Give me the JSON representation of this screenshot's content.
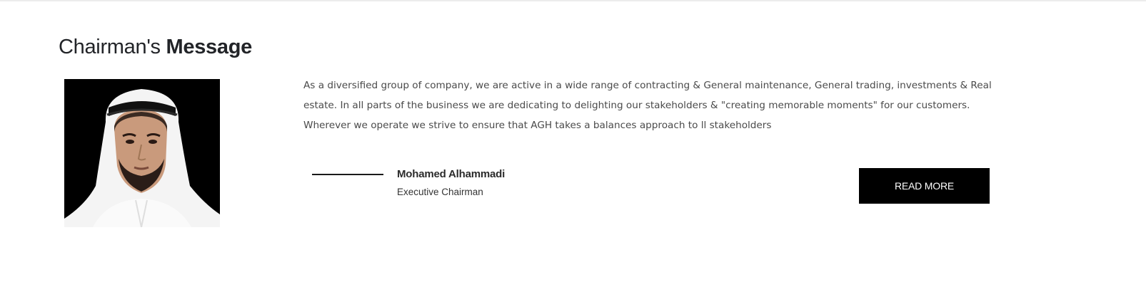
{
  "section": {
    "title_regular": "Chairman's",
    "title_bold": "Message",
    "message": "As a diversified group of company, we are active in a wide range of contracting & General maintenance, General trading, investments & Real estate. In all parts of the business we are dedicating to delighting our stakeholders & \"creating memorable moments\" for our customers. Wherever we operate we strive to ensure that AGH takes a balances approach to ll stakeholders",
    "signature": {
      "name": "Mohamed Alhammadi",
      "role": "Executive Chairman"
    },
    "read_more_label": "READ MORE"
  },
  "colors": {
    "background": "#ffffff",
    "text_dark": "#222428",
    "body_text": "#4a4a4a",
    "button_bg": "#000000",
    "button_text": "#ffffff"
  }
}
